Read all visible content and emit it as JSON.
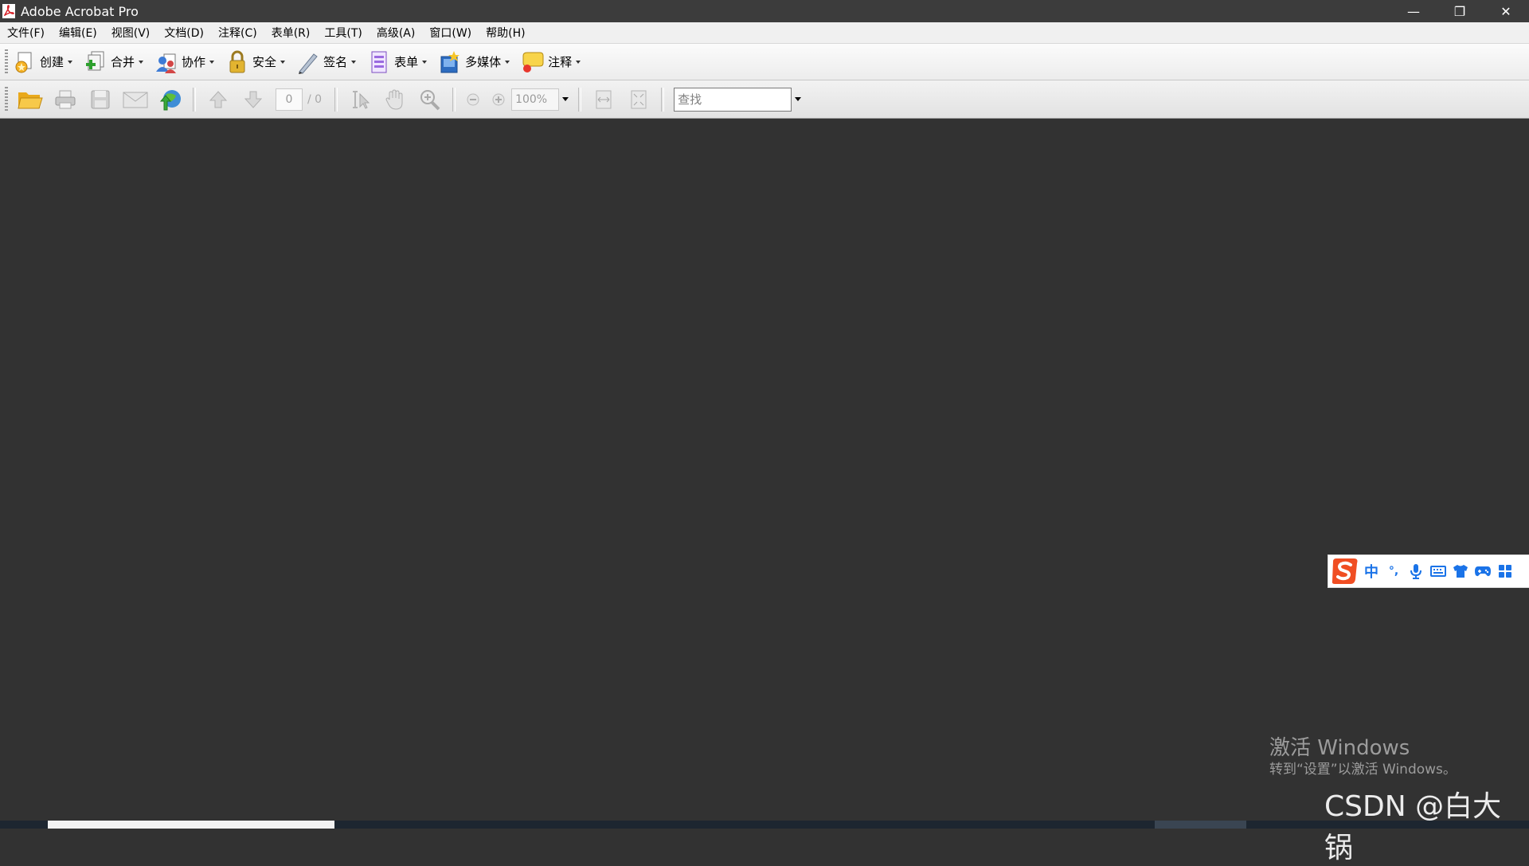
{
  "window": {
    "title": "Adobe Acrobat Pro",
    "controls": {
      "minimize": "—",
      "restore": "❐",
      "close": "✕"
    }
  },
  "menubar": {
    "items": [
      "文件(F)",
      "编辑(E)",
      "视图(V)",
      "文档(D)",
      "注释(C)",
      "表单(R)",
      "工具(T)",
      "高级(A)",
      "窗口(W)",
      "帮助(H)"
    ]
  },
  "ribbon": {
    "buttons": [
      {
        "label": "创建",
        "icon": "create-icon"
      },
      {
        "label": "合并",
        "icon": "combine-icon"
      },
      {
        "label": "协作",
        "icon": "collaborate-icon"
      },
      {
        "label": "安全",
        "icon": "lock-icon"
      },
      {
        "label": "签名",
        "icon": "pen-icon"
      },
      {
        "label": "表单",
        "icon": "form-icon"
      },
      {
        "label": "多媒体",
        "icon": "multimedia-icon"
      },
      {
        "label": "注释",
        "icon": "comment-icon"
      }
    ]
  },
  "toolbar": {
    "page_current": "0",
    "page_total": "/ 0",
    "zoom": "100%",
    "search_placeholder": "查找"
  },
  "ime": {
    "items": [
      "中",
      "°,",
      "mic-icon",
      "keyboard-icon",
      "shirt-icon",
      "gamepad-icon",
      "grid-icon"
    ]
  },
  "watermark": {
    "activate_title": "激活 Windows",
    "activate_sub": "转到“设置”以激活 Windows。",
    "csdn": "CSDN @白大锅"
  },
  "colors": {
    "workspace": "#323232",
    "titlebar": "#3c3c3c",
    "acrobat_red": "#d71f26"
  }
}
